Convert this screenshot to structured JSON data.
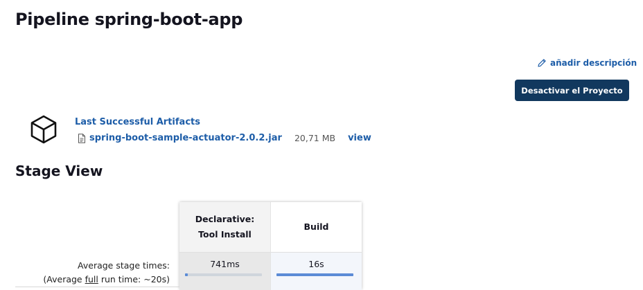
{
  "header": {
    "title": "Pipeline spring-boot-app"
  },
  "actions": {
    "add_description": "añadir descripción",
    "disable_project": "Desactivar el Proyecto"
  },
  "artifacts": {
    "title": "Last Successful Artifacts",
    "file_name": "spring-boot-sample-actuator-2.0.2.jar",
    "file_size": "20,71 MB",
    "view_label": "view"
  },
  "stage_view": {
    "title": "Stage View",
    "avg_label_line1": "Average stage times:",
    "avg_label_line2_prefix": "(Average ",
    "avg_label_line2_link": "full",
    "avg_label_line2_suffix": " run time: ~20s)",
    "stages": [
      {
        "name_line1": "Declarative:",
        "name_line2": "Tool Install",
        "avg_time": "741ms",
        "progress": 0.04
      },
      {
        "name_line1": "Build",
        "name_line2": "",
        "avg_time": "16s",
        "progress": 1.0
      }
    ]
  },
  "colors": {
    "link": "#1d5da8",
    "button_bg": "#11385e",
    "progress": "#5b8bd6"
  },
  "icons": {
    "edit": "pencil-icon",
    "artifacts": "package-icon",
    "file": "file-icon"
  }
}
